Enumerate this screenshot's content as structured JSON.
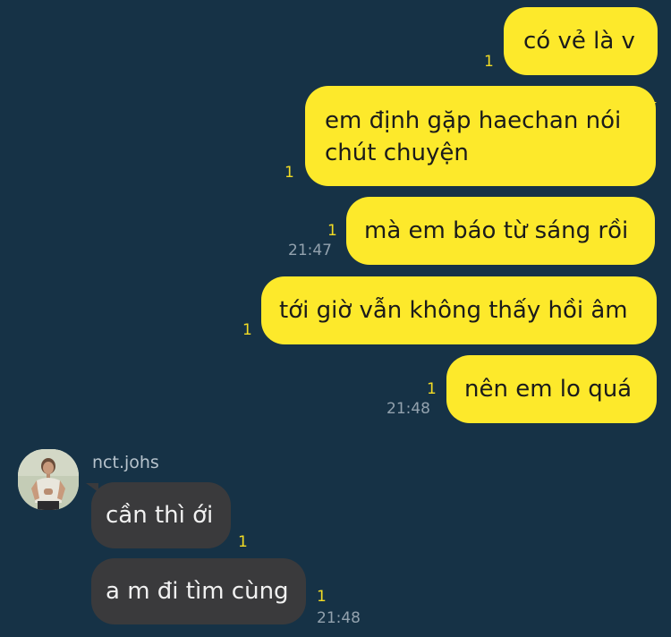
{
  "messages": [
    {
      "text": "có vẻ là v",
      "unread": "1",
      "time": ""
    },
    {
      "text_line1": "em định gặp haechan nói",
      "text_line2": "chút chuyện",
      "unread": "1",
      "time": ""
    },
    {
      "text": "mà em báo từ sáng rồi",
      "unread": "1",
      "time": "21:47"
    },
    {
      "text": "tới giờ vẫn không thấy hồi âm",
      "unread": "1",
      "time": ""
    },
    {
      "text": "nên em lo quá",
      "unread": "1",
      "time": "21:48"
    }
  ],
  "contact": {
    "name": "nct.johs",
    "messages": [
      {
        "text": "cần thì ới",
        "unread": "1",
        "time": ""
      },
      {
        "text": "a m đi tìm cùng",
        "unread": "1",
        "time": "21:48"
      }
    ]
  },
  "colors": {
    "background": "#163246",
    "outgoing_bubble": "#fde92b",
    "incoming_bubble": "#3a3a3c",
    "unread_count": "#f3dc24",
    "timestamp": "#93a2ae"
  }
}
